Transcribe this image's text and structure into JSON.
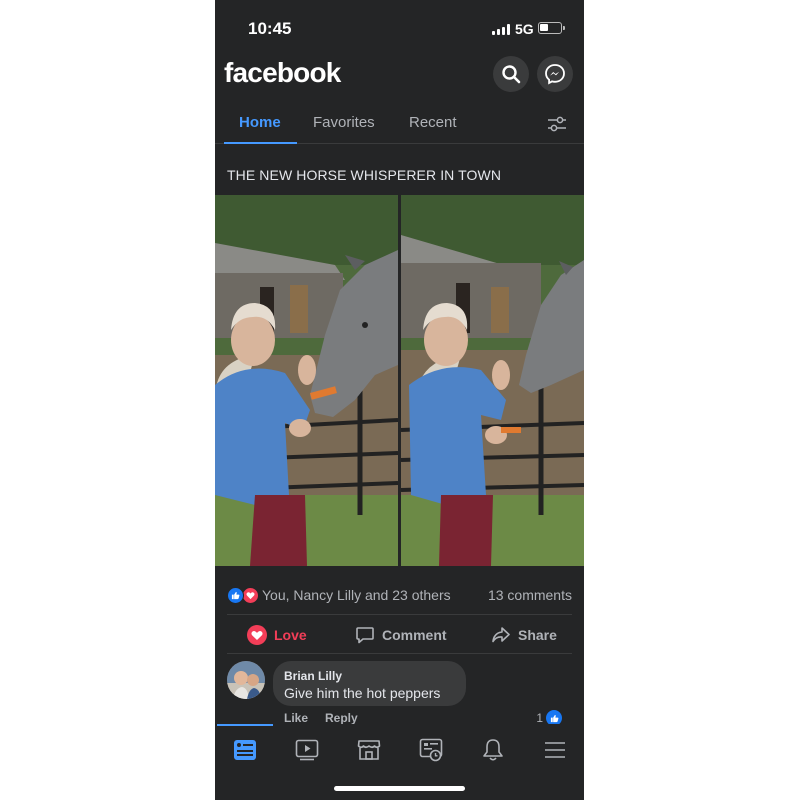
{
  "status_bar": {
    "time": "10:45",
    "network": "5G",
    "battery_level": 0.4
  },
  "header": {
    "brand": "facebook",
    "search_icon": "search-icon",
    "messenger_icon": "messenger-icon"
  },
  "tabs": [
    {
      "label": "Home",
      "active": true
    },
    {
      "label": "Favorites",
      "active": false
    },
    {
      "label": "Recent",
      "active": false
    }
  ],
  "post": {
    "text": "THE NEW HORSE WHISPERER IN TOWN",
    "reaction_summary": "You, Nancy Lilly and 23 others",
    "comments_count": "13 comments",
    "actions": {
      "love": "Love",
      "comment": "Comment",
      "share": "Share"
    }
  },
  "comment": {
    "author": "Brian Lilly",
    "text": "Give him the hot peppers",
    "like": "Like",
    "reply": "Reply",
    "likes": "1"
  },
  "bottom_nav": [
    "home-feed-icon",
    "video-icon",
    "marketplace-icon",
    "news-icon",
    "notifications-icon",
    "menu-icon"
  ],
  "colors": {
    "accent": "#4599ff",
    "love": "#f33e58",
    "background": "#242526",
    "surface": "#3a3b3c"
  }
}
